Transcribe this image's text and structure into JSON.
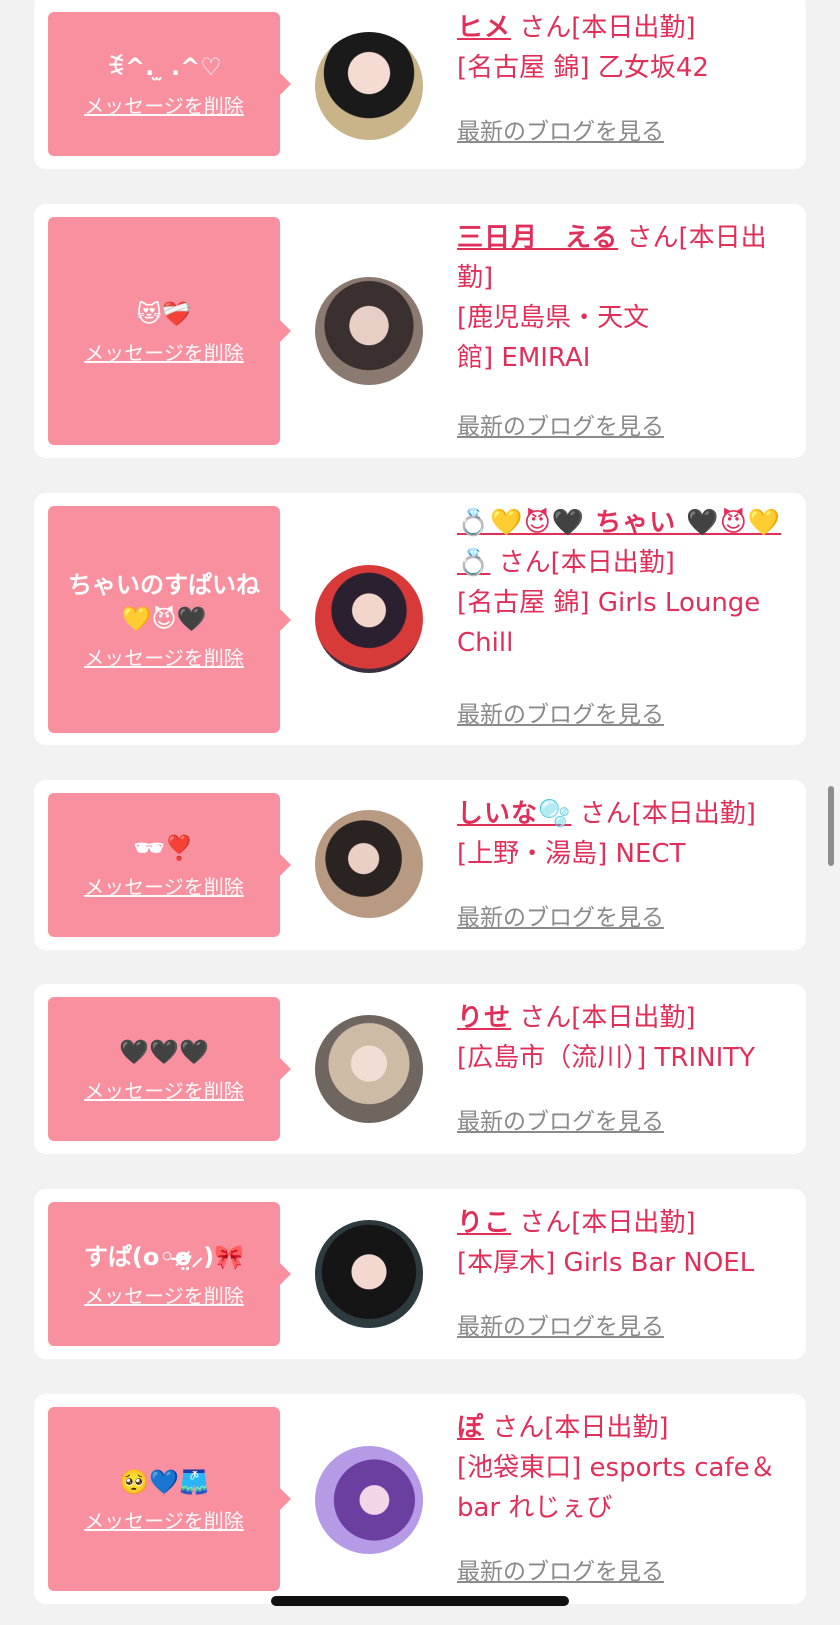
{
  "delete_label": "メッセージを削除",
  "blog_label": "最新のブログを見る",
  "san_label": "さん[本日出勤]",
  "entries": [
    {
      "message": "ꉂ^. ̫ .^♡",
      "name": "ヒメ",
      "shop": "[名古屋 錦] 乙女坂42"
    },
    {
      "message": "😻❤️‍🩹",
      "name": "三日月　える",
      "shop": "[鹿児島県・天文館] EMIRAI"
    },
    {
      "message": "ちゃいのすぱいね\n💛😈🖤",
      "name": "💍💛😈🖤 ちゃい 🖤😈💛💍",
      "shop": "[名古屋 錦] Girls Lounge Chill"
    },
    {
      "message": "🕶❣️",
      "name": "しいな🫧",
      "shop": "[上野・湯島] NECT"
    },
    {
      "message": "🖤🖤🖤",
      "name": "りせ",
      "shop": "[広島市（流川）] TRINITY"
    },
    {
      "message": "すぱ(o◦o̴̶̷̤⸝)🎀",
      "name": "りこ",
      "shop": "[本厚木] Girls Bar NOEL"
    },
    {
      "message": "🥺💙🩳",
      "name": "ぽ",
      "shop": "[池袋東口] esports cafe＆bar れじぇび"
    }
  ]
}
